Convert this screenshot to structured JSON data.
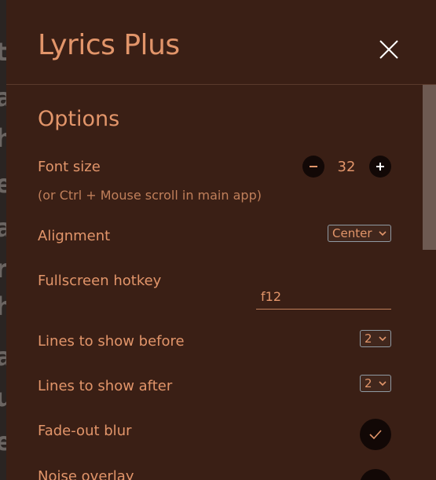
{
  "background": {
    "letters": [
      "t",
      "a",
      "h",
      "e",
      "a",
      "r",
      "h",
      "h",
      "a",
      "u",
      "e"
    ]
  },
  "modal": {
    "title": "Lyrics Plus",
    "close_icon": "close-icon"
  },
  "options": {
    "section_title": "Options",
    "font_size": {
      "label": "Font size",
      "hint": "(or Ctrl + Mouse scroll in main app)",
      "value": "32",
      "decrease_icon": "minus-icon",
      "increase_icon": "plus-icon"
    },
    "alignment": {
      "label": "Alignment",
      "selected": "Center"
    },
    "fullscreen_hotkey": {
      "label": "Fullscreen hotkey",
      "value": "f12"
    },
    "lines_before": {
      "label": "Lines to show before",
      "selected": "2"
    },
    "lines_after": {
      "label": "Lines to show after",
      "selected": "2"
    },
    "fade_blur": {
      "label": "Fade-out blur",
      "checked": true,
      "icon": "check-icon"
    },
    "noise": {
      "label": "Noise overlay"
    }
  },
  "colors": {
    "modal_bg": "#3a1f15",
    "accent": "#e2956a",
    "button_bg": "#120806",
    "backdrop_text": "#6b6562"
  }
}
